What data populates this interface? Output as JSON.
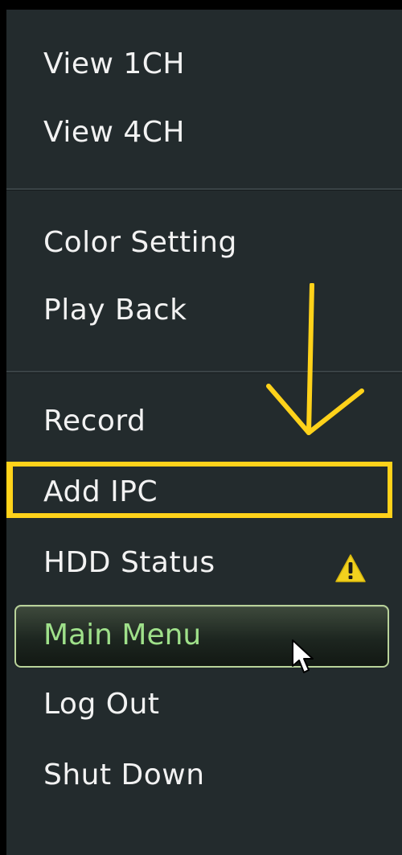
{
  "menu": {
    "items": [
      {
        "label": "View 1CH"
      },
      {
        "label": "View 4CH"
      },
      {
        "label": "Color Setting"
      },
      {
        "label": "Play Back"
      },
      {
        "label": "Record"
      },
      {
        "label": "Add IPC"
      },
      {
        "label": "HDD Status"
      },
      {
        "label": "Main Menu"
      },
      {
        "label": "Log Out"
      },
      {
        "label": "Shut Down"
      }
    ],
    "selected_item": "Main Menu",
    "hdd_status_badge": "warning-icon"
  },
  "annotation": {
    "arrow": "down-arrow-icon",
    "highlight_target": "Add IPC",
    "color": "#ffd21a"
  },
  "colors": {
    "menu_background": "#232b2d",
    "text": "#f2f2f2",
    "selected_text": "#9fe08a",
    "selected_border": "#b9d39a",
    "warning_fill": "#f2d21e"
  }
}
